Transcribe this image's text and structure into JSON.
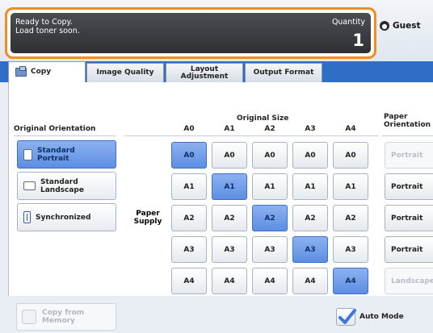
{
  "status": {
    "line1": "Ready to Copy.",
    "line2": "Load toner soon.",
    "quantity_label": "Quantity",
    "quantity_value": "1"
  },
  "user": {
    "label": "Guest"
  },
  "tabs": [
    {
      "label": "Copy",
      "active": true
    },
    {
      "label": "Image Quality",
      "active": false
    },
    {
      "label": "Layout Adjustment",
      "active": false
    },
    {
      "label": "Output Format",
      "active": false
    }
  ],
  "headers": {
    "original_orientation": "Original Orientation",
    "original_size": "Original Size",
    "paper_orientation": "Paper Orientation",
    "paper_supply": "Paper Supply"
  },
  "original_size_columns": [
    "A0",
    "A1",
    "A2",
    "A3",
    "A4"
  ],
  "orientation_buttons": [
    {
      "label": "Standard Portrait",
      "selected": true,
      "icon": "portrait-icon"
    },
    {
      "label": "Standard Landscape",
      "selected": false,
      "icon": "landscape-icon"
    },
    {
      "label": "Synchronized",
      "selected": false,
      "icon": "synchronized-icon"
    }
  ],
  "paper_supply_rows": [
    {
      "cells": [
        "A0",
        "A0",
        "A0",
        "A0",
        "A0"
      ],
      "selected_index": 0
    },
    {
      "cells": [
        "A1",
        "A1",
        "A1",
        "A1",
        "A1"
      ],
      "selected_index": 1
    },
    {
      "cells": [
        "A2",
        "A2",
        "A2",
        "A2",
        "A2"
      ],
      "selected_index": 2
    },
    {
      "cells": [
        "A3",
        "A3",
        "A3",
        "A3",
        "A3"
      ],
      "selected_index": 3
    },
    {
      "cells": [
        "A4",
        "A4",
        "A4",
        "A4",
        "A4"
      ],
      "selected_index": 4
    }
  ],
  "paper_orientation": [
    {
      "label": "Portrait",
      "enabled": false
    },
    {
      "label": "Portrait",
      "enabled": true
    },
    {
      "label": "Portrait",
      "enabled": true
    },
    {
      "label": "Portrait",
      "enabled": true
    },
    {
      "label": "Landscape",
      "enabled": false
    }
  ],
  "bottom": {
    "copy_from_memory": "Copy from Memory",
    "auto_mode": "Auto Mode",
    "auto_mode_checked": true
  },
  "colors": {
    "accent": "#2f6ec7",
    "selected": "#6f9be6",
    "status_border": "#f28c1e"
  }
}
